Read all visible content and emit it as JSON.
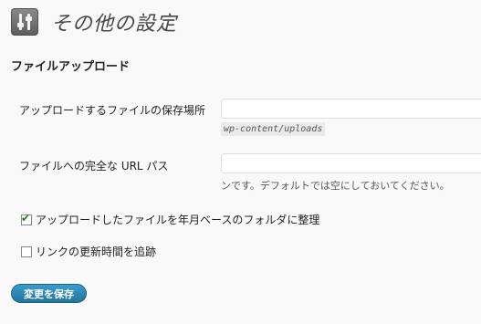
{
  "page": {
    "title": "その他の設定",
    "icon": "settings-sliders-icon"
  },
  "uploads": {
    "section_title": "ファイルアップロード",
    "upload_path_label": "アップロードするファイルの保存場所",
    "upload_path_value": "",
    "upload_path_default": "wp-content/uploads",
    "full_url_label": "ファイルへの完全な URL パス",
    "full_url_value": "",
    "full_url_help": "ンです。デフォルトでは空にしておいてください。",
    "organize_label": "アップロードしたファイルを年月ベースのフォルダに整理",
    "organize_checked": true
  },
  "links": {
    "track_updates_label": "リンクの更新時間を追跡",
    "track_updates_checked": false
  },
  "actions": {
    "save_label": "変更を保存"
  },
  "colors": {
    "accent": "#21759b",
    "check": "#2a7a18"
  }
}
